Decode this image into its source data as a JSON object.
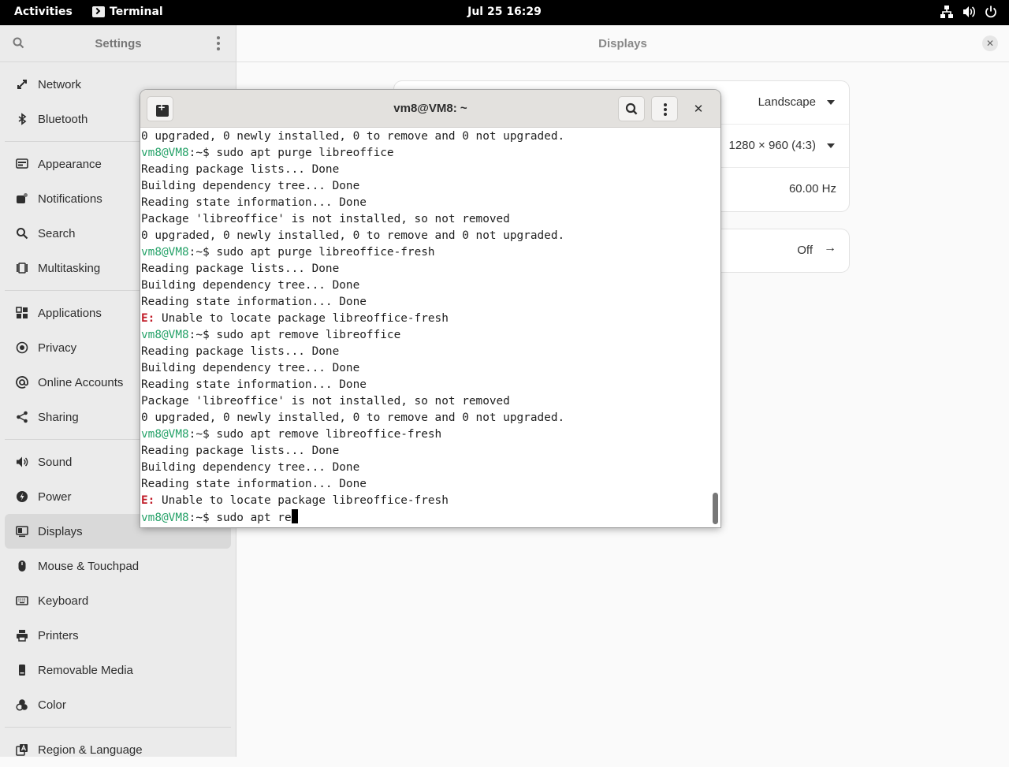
{
  "topbar": {
    "activities": "Activities",
    "app_name": "Terminal",
    "clock": "Jul 25  16:29",
    "icons": [
      "network-icon",
      "volume-icon",
      "power-icon"
    ]
  },
  "settings": {
    "title": "Settings",
    "nav": [
      {
        "label": "Network",
        "icon": "network-icon"
      },
      {
        "label": "Bluetooth",
        "icon": "bluetooth-icon"
      },
      {
        "label": "Appearance",
        "icon": "appearance-icon"
      },
      {
        "label": "Notifications",
        "icon": "notifications-icon"
      },
      {
        "label": "Search",
        "icon": "search-icon"
      },
      {
        "label": "Multitasking",
        "icon": "multitasking-icon"
      },
      {
        "label": "Applications",
        "icon": "applications-icon"
      },
      {
        "label": "Privacy",
        "icon": "privacy-icon"
      },
      {
        "label": "Online Accounts",
        "icon": "online-accounts-icon"
      },
      {
        "label": "Sharing",
        "icon": "sharing-icon"
      },
      {
        "label": "Sound",
        "icon": "sound-icon"
      },
      {
        "label": "Power",
        "icon": "power-icon"
      },
      {
        "label": "Displays",
        "icon": "displays-icon"
      },
      {
        "label": "Mouse & Touchpad",
        "icon": "mouse-icon"
      },
      {
        "label": "Keyboard",
        "icon": "keyboard-icon"
      },
      {
        "label": "Printers",
        "icon": "printer-icon"
      },
      {
        "label": "Removable Media",
        "icon": "removable-media-icon"
      },
      {
        "label": "Color",
        "icon": "color-icon"
      },
      {
        "label": "Region & Language",
        "icon": "region-icon"
      }
    ],
    "active": "Displays"
  },
  "displays": {
    "title": "Displays",
    "orientation": "Landscape",
    "resolution": "1280 × 960 (4:3)",
    "refresh_rate": "60.00 Hz",
    "night_light": "Off"
  },
  "terminal": {
    "title": "vm8@VM8: ~",
    "prompt_user": "vm8@VM8",
    "prompt_suffix": ":~$ ",
    "lines": [
      {
        "kind": "text",
        "text": "0 upgraded, 0 newly installed, 0 to remove and 0 not upgraded."
      },
      {
        "kind": "prompt",
        "text": "sudo apt purge libreoffice"
      },
      {
        "kind": "text",
        "text": "Reading package lists... Done"
      },
      {
        "kind": "text",
        "text": "Building dependency tree... Done"
      },
      {
        "kind": "text",
        "text": "Reading state information... Done"
      },
      {
        "kind": "text",
        "text": "Package 'libreoffice' is not installed, so not removed"
      },
      {
        "kind": "text",
        "text": "0 upgraded, 0 newly installed, 0 to remove and 0 not upgraded."
      },
      {
        "kind": "prompt",
        "text": "sudo apt purge libreoffice-fresh"
      },
      {
        "kind": "text",
        "text": "Reading package lists... Done"
      },
      {
        "kind": "text",
        "text": "Building dependency tree... Done"
      },
      {
        "kind": "text",
        "text": "Reading state information... Done"
      },
      {
        "kind": "error",
        "prefix": "E:",
        "text": " Unable to locate package libreoffice-fresh"
      },
      {
        "kind": "prompt",
        "text": "sudo apt remove libreoffice"
      },
      {
        "kind": "text",
        "text": "Reading package lists... Done"
      },
      {
        "kind": "text",
        "text": "Building dependency tree... Done"
      },
      {
        "kind": "text",
        "text": "Reading state information... Done"
      },
      {
        "kind": "text",
        "text": "Package 'libreoffice' is not installed, so not removed"
      },
      {
        "kind": "text",
        "text": "0 upgraded, 0 newly installed, 0 to remove and 0 not upgraded."
      },
      {
        "kind": "prompt",
        "text": "sudo apt remove libreoffice-fresh"
      },
      {
        "kind": "text",
        "text": "Reading package lists... Done"
      },
      {
        "kind": "text",
        "text": "Building dependency tree... Done"
      },
      {
        "kind": "text",
        "text": "Reading state information... Done"
      },
      {
        "kind": "error",
        "prefix": "E:",
        "text": " Unable to locate package libreoffice-fresh"
      },
      {
        "kind": "current",
        "text": "sudo apt re"
      }
    ]
  },
  "colors": {
    "prompt_green": "#26a269",
    "error_red": "#c01c28",
    "topbar_bg": "#000000",
    "sidebar_bg": "#ebebeb"
  }
}
